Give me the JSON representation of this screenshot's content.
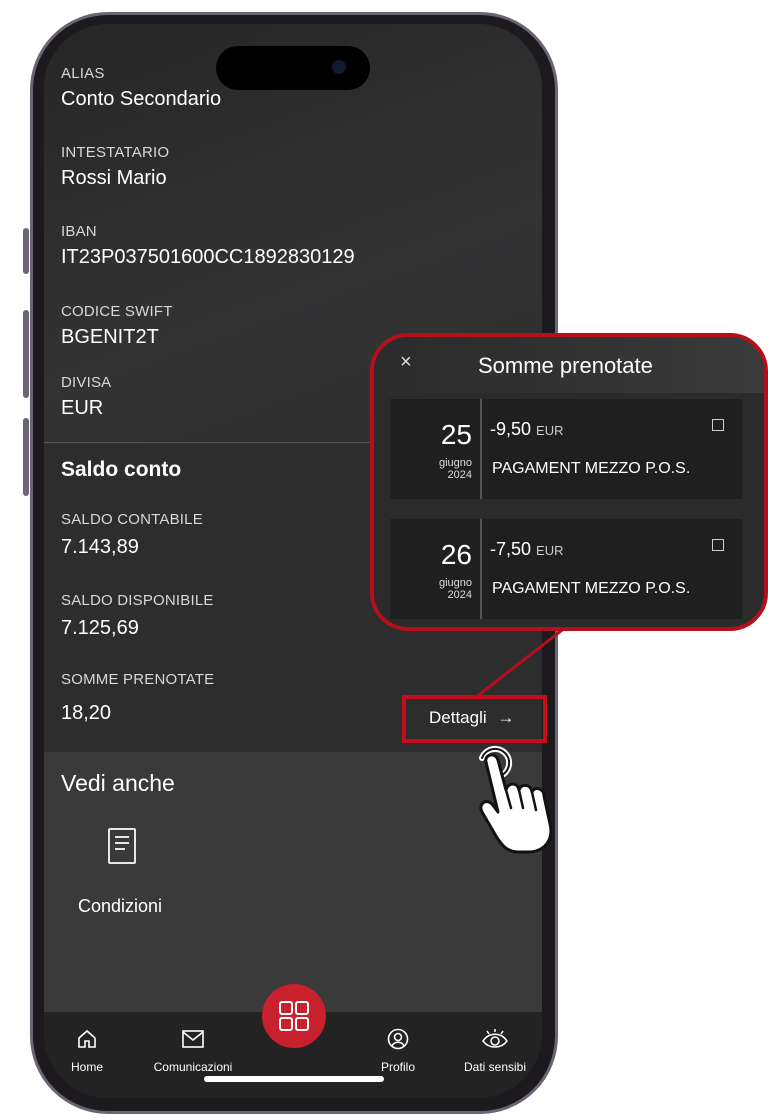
{
  "account_info": {
    "alias": {
      "label": "ALIAS",
      "value": "Conto Secondario"
    },
    "intestatario": {
      "label": "INTESTATARIO",
      "value": "Rossi Mario"
    },
    "iban": {
      "label": "IBAN",
      "value": "IT23P037501600CC1892830129"
    },
    "swift": {
      "label": "CODICE SWIFT",
      "value": "BGENIT2T"
    },
    "divisa": {
      "label": "DIVISA",
      "value": "EUR"
    }
  },
  "saldo": {
    "title": "Saldo conto",
    "contabile": {
      "label": "SALDO CONTABILE",
      "value": "7.143,89"
    },
    "disponibile": {
      "label": "SALDO DISPONIBILE",
      "value": "7.125,69"
    },
    "prenotate": {
      "label": "SOMME PRENOTATE",
      "value": "18,20"
    },
    "dettagli_label": "Dettagli",
    "dettagli_arrow": "→"
  },
  "vedi_anche": {
    "title": "Vedi anche",
    "item_label": "Condizioni"
  },
  "popup": {
    "close": "×",
    "title": "Somme prenotate",
    "transactions": [
      {
        "day": "25",
        "month": "giugno",
        "year": "2024",
        "amount": "-9,50",
        "currency": "EUR",
        "description": "PAGAMENT MEZZO P.O.S."
      },
      {
        "day": "26",
        "month": "giugno",
        "year": "2024",
        "amount": "-7,50",
        "currency": "EUR",
        "description": "PAGAMENT MEZZO P.O.S."
      }
    ]
  },
  "tabbar": {
    "home": "Home",
    "comunicazioni": "Comunicazioni",
    "profilo": "Profilo",
    "dati_sensibili": "Dati sensibi"
  },
  "colors": {
    "accent": "#c8202d",
    "highlight_border": "#b3101c",
    "background": "#2d2d2e"
  },
  "icons": {
    "home": "home-icon",
    "comunicazioni": "mail-icon",
    "menu": "grid-icon",
    "profilo": "profile-icon",
    "dati_sensibili": "eye-icon",
    "condizioni": "document-check-icon",
    "close": "close-icon",
    "external": "external-link-icon"
  }
}
